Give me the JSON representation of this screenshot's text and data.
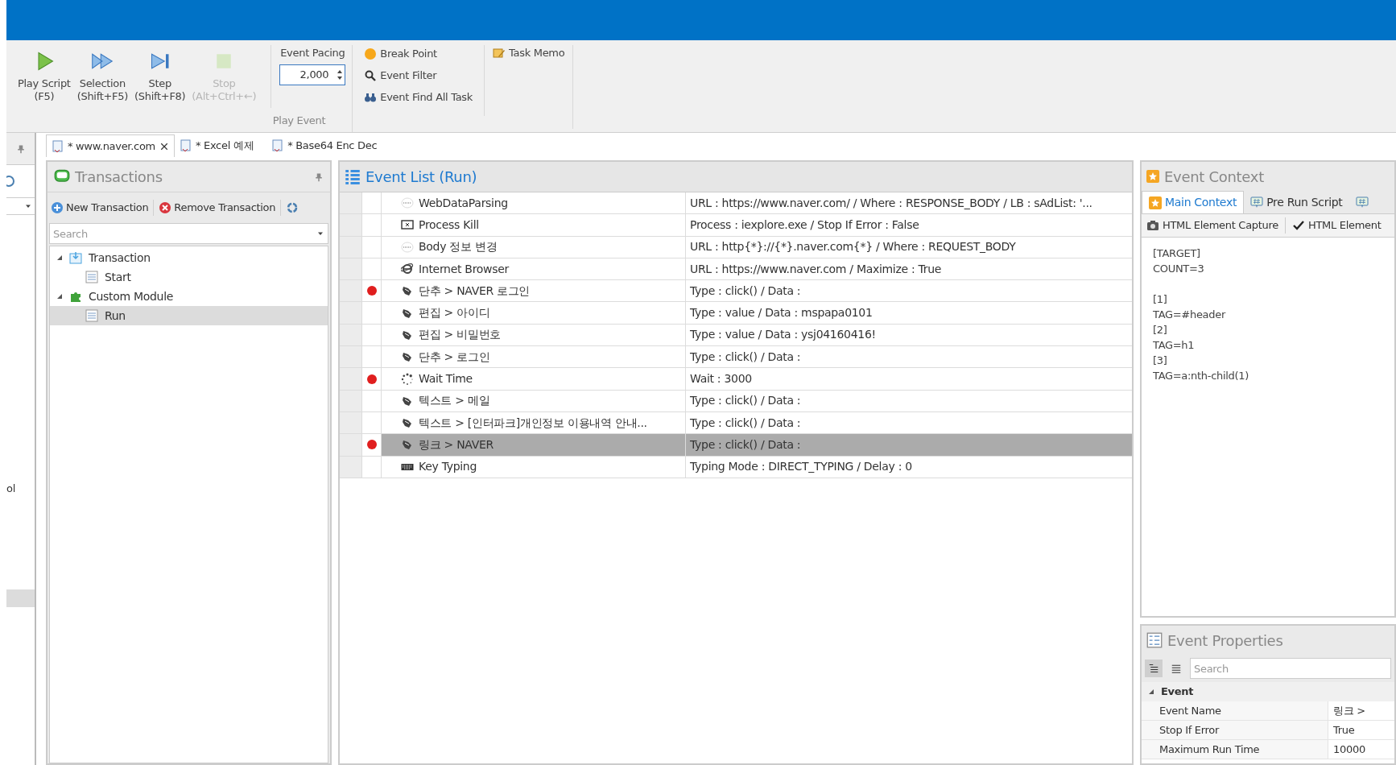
{
  "toolbar": {
    "buttons": [
      {
        "label": "Play Script",
        "shortcut": "(F5)",
        "kind": "play",
        "disabled": false
      },
      {
        "label": "Selection",
        "shortcut": "(Shift+F5)",
        "kind": "selection",
        "disabled": false
      },
      {
        "label": "Step",
        "shortcut": "(Shift+F8)",
        "kind": "step",
        "disabled": false
      },
      {
        "label": "Stop",
        "shortcut": "(Alt+Ctrl+←)",
        "kind": "stop",
        "disabled": true
      }
    ],
    "pacing": {
      "label": "Event Pacing",
      "value": "2,000"
    },
    "group_label": "Play Event",
    "tools": [
      {
        "label": "Break Point",
        "kind": "breakpoint"
      },
      {
        "label": "Event Filter",
        "kind": "filter"
      },
      {
        "label": "Event Find All Task",
        "kind": "find"
      }
    ],
    "memo": "Task Memo"
  },
  "left_strip": {
    "fragment": "ol"
  },
  "doc_tabs": [
    {
      "label": "* www.naver.com",
      "selected": true,
      "closable": true
    },
    {
      "label": "* Excel 예제",
      "selected": false,
      "closable": false
    },
    {
      "label": "* Base64 Enc Dec",
      "selected": false,
      "closable": false
    }
  ],
  "transactions": {
    "title": "Transactions",
    "new": "New Transaction",
    "remove": "Remove Transaction",
    "search_placeholder": "Search",
    "tree": [
      {
        "label": "Transaction",
        "kind": "transaction",
        "expanded": true,
        "selected": false,
        "children": [
          {
            "label": "Start",
            "kind": "list",
            "selected": false
          }
        ]
      },
      {
        "label": "Custom Module",
        "kind": "module",
        "expanded": true,
        "selected": false,
        "children": [
          {
            "label": "Run",
            "kind": "list",
            "selected": true
          }
        ]
      }
    ]
  },
  "event_list": {
    "title": "Event List (Run)",
    "rows": [
      {
        "name": "WebDataParsing",
        "kind": "web",
        "details": "URL : https://www.naver.com/ / Where : RESPONSE_BODY / LB : sAdList: '...",
        "breakpoint": false,
        "selected": false
      },
      {
        "name": "Process Kill",
        "kind": "kill",
        "details": "Process : iexplore.exe / Stop If Error : False",
        "breakpoint": false,
        "selected": false
      },
      {
        "name": "Body 정보 변경",
        "kind": "web",
        "details": "URL : http{*}://{*}.naver.com{*} / Where : REQUEST_BODY",
        "breakpoint": false,
        "selected": false
      },
      {
        "name": "Internet Browser",
        "kind": "browser",
        "details": "URL : https://www.naver.com / Maximize : True",
        "breakpoint": false,
        "selected": false
      },
      {
        "name": "단추 > NAVER 로그인",
        "kind": "action",
        "details": "Type : click() / Data :",
        "breakpoint": true,
        "selected": false
      },
      {
        "name": "편집 > 아이디",
        "kind": "action",
        "details": "Type : value / Data : mspapa0101",
        "breakpoint": false,
        "selected": false
      },
      {
        "name": "편집 > 비밀번호",
        "kind": "action",
        "details": "Type : value / Data : ysj04160416!",
        "breakpoint": false,
        "selected": false
      },
      {
        "name": "단추 > 로그인",
        "kind": "action",
        "details": "Type : click() / Data :",
        "breakpoint": false,
        "selected": false
      },
      {
        "name": "Wait Time",
        "kind": "wait",
        "details": "Wait : 3000",
        "breakpoint": true,
        "selected": false
      },
      {
        "name": "텍스트 > 메일",
        "kind": "action",
        "details": "Type : click() / Data :",
        "breakpoint": false,
        "selected": false
      },
      {
        "name": "텍스트 > [인터파크]개인정보 이용내역 안내...",
        "kind": "action",
        "details": "Type : click() / Data :",
        "breakpoint": false,
        "selected": false
      },
      {
        "name": "링크 > NAVER",
        "kind": "action",
        "details": "Type : click() / Data :",
        "breakpoint": true,
        "selected": true
      },
      {
        "name": "Key Typing",
        "kind": "keyboard",
        "details": "Typing Mode : DIRECT_TYPING / Delay : 0",
        "breakpoint": false,
        "selected": false
      }
    ]
  },
  "event_context": {
    "title": "Event Context",
    "tabs": [
      {
        "label": "Main Context",
        "selected": true,
        "kind": "star"
      },
      {
        "label": "Pre Run Script",
        "selected": false,
        "kind": "script"
      },
      {
        "selected": false,
        "kind": "script"
      }
    ],
    "tools": [
      {
        "label": "HTML Element Capture",
        "kind": "camera"
      },
      {
        "label": "HTML Element",
        "kind": "check"
      }
    ],
    "paragraphs": [
      [
        "[TARGET]",
        "COUNT=3"
      ],
      [
        "[1]",
        "TAG=#header",
        "[2]",
        "TAG=h1",
        "[3]",
        "TAG=a:nth-child(1)"
      ]
    ]
  },
  "event_properties": {
    "title": "Event Properties",
    "search_placeholder": "Search",
    "category": "Event",
    "rows": [
      {
        "name": "Event Name",
        "value": "링크 >"
      },
      {
        "name": "Stop If Error",
        "value": "True"
      },
      {
        "name": "Maximum Run Time",
        "value": "10000"
      }
    ]
  }
}
